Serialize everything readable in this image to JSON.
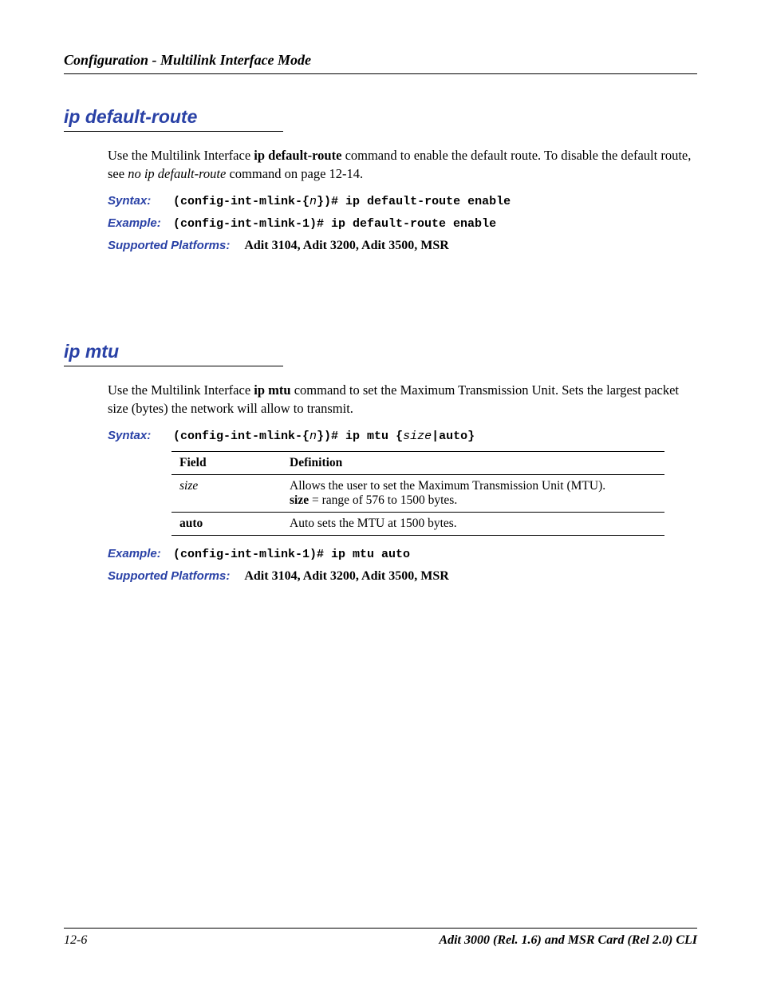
{
  "header": {
    "title": "Configuration - Multilink Interface Mode"
  },
  "section1": {
    "heading": "ip default-route",
    "body_prefix": "Use the Multilink Interface ",
    "body_bold1": "ip default-route",
    "body_mid": " command to enable the default route. To disable the default route, see ",
    "body_italic": "no ip default-route",
    "body_suffix": " command on page 12-14.",
    "syntax_label": "Syntax:",
    "syntax_pre": "(config-int-mlink-{",
    "syntax_param": "n",
    "syntax_post": "})# ip default-route enable",
    "example_label": "Example:",
    "example_text": "(config-int-mlink-1)# ip default-route enable",
    "platforms_label": "Supported Platforms:",
    "platforms_text": "Adit 3104, Adit 3200, Adit 3500, MSR"
  },
  "section2": {
    "heading": "ip mtu",
    "body_prefix": "Use the Multilink Interface ",
    "body_bold1": "ip mtu",
    "body_suffix": " command to set the Maximum Transmission Unit. Sets the largest packet size (bytes) the network will allow to transmit.",
    "syntax_label": "Syntax:",
    "syntax_pre": "(config-int-mlink-{",
    "syntax_param1": "n",
    "syntax_mid": "})# ip mtu {",
    "syntax_param2": "size",
    "syntax_sep": "|",
    "syntax_bold2": "auto",
    "syntax_post": "}",
    "table": {
      "header_field": "Field",
      "header_def": "Definition",
      "rows": [
        {
          "field_italic": "size",
          "def_line1": "Allows the user to set the Maximum  Transmission Unit (MTU).",
          "def_bold": "size",
          "def_line2": " = range of 576 to 1500 bytes."
        },
        {
          "field_bold": "auto",
          "def_line1": "Auto sets the MTU at 1500 bytes."
        }
      ]
    },
    "example_label": "Example:",
    "example_text": "(config-int-mlink-1)# ip mtu auto",
    "platforms_label": "Supported Platforms:",
    "platforms_text": "Adit 3104, Adit 3200, Adit 3500, MSR"
  },
  "footer": {
    "page": "12-6",
    "doc": "Adit 3000 (Rel. 1.6) and MSR Card (Rel 2.0) CLI"
  }
}
